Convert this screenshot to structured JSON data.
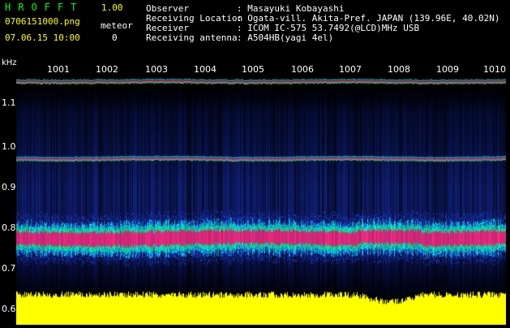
{
  "header": {
    "app_title": "HROFFT",
    "version": "1.00",
    "filename": "0706151000.png",
    "datetime": "07.06.15 10:00",
    "meteor_label": "meteor",
    "meteor_count": "0"
  },
  "info": [
    {
      "key": "Observer",
      "value": ": Masayuki Kobayashi"
    },
    {
      "key": "Receiving Location",
      "value": ": Ogata-vill. Akita-Pref. JAPAN (139.96E, 40.02N)"
    },
    {
      "key": "Receiver",
      "value": ": ICOM IC-575 53.7492(@LCD)MHz USB"
    },
    {
      "key": "Receiving antenna",
      "value": ": A504HB(yagi 4el)"
    }
  ],
  "axes": {
    "unit_label": "kHz",
    "x_ticks": [
      "1001",
      "1002",
      "1003",
      "1004",
      "1005",
      "1006",
      "1007",
      "1008",
      "1009",
      "1010"
    ],
    "y_ticks": [
      "1.1",
      "1.0",
      "0.9",
      "0.8",
      "0.7",
      "0.6"
    ]
  },
  "colors": {
    "background": "#000000",
    "noise_floor": "#0a1a6a",
    "signal_cyan": "#00ffff",
    "signal_green": "#00ff66",
    "signal_magenta": "#ff2d80",
    "baseline_yellow": "#ffff00",
    "title_green": "#00ff00",
    "text_yellow": "#ffff00"
  }
}
